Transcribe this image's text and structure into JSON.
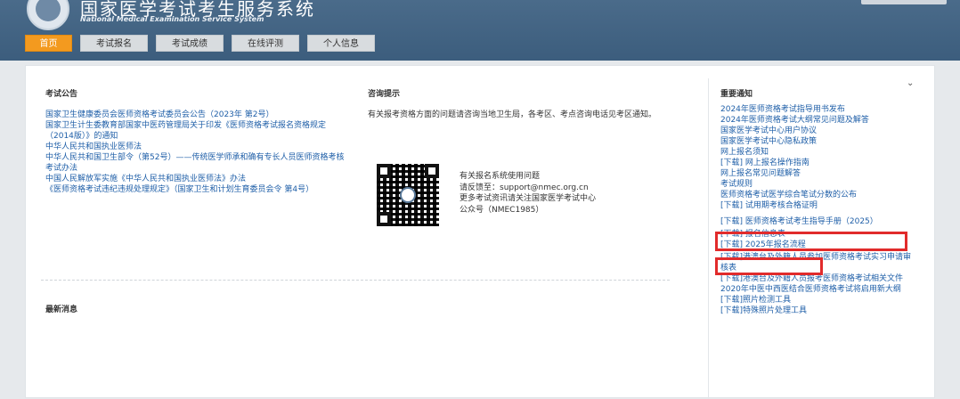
{
  "header": {
    "title": "国家医学考试考生服务系统",
    "subtitle": "National Medical Examination Service System"
  },
  "nav": {
    "items": [
      {
        "label": "首页"
      },
      {
        "label": "考试报名"
      },
      {
        "label": "考试成绩"
      },
      {
        "label": "在线评测"
      },
      {
        "label": "个人信息"
      }
    ]
  },
  "announcements": {
    "title": "考试公告",
    "items": [
      "国家卫生健康委员会医师资格考试委员会公告（2023年 第2号）",
      "国家卫生计生委教育部国家中医药管理局关于印发《医师资格考试报名资格规定（2014版）》的通知",
      "中华人民共和国执业医师法",
      "中华人民共和国卫生部令（第52号）——传统医学师承和确有专长人员医师资格考核考试办法",
      "中国人民解放军实施《中华人民共和国执业医师法》办法",
      "《医师资格考试违纪违规处理规定》（国家卫生和计划生育委员会令 第4号）"
    ]
  },
  "consult": {
    "title": "咨询提示",
    "text": "有关报考资格方面的问题请咨询当地卫生局，各考区、考点咨询电话见考区通知。",
    "contact_lines": [
      "有关报名系统使用问题",
      "请反馈至：support@nmec.org.cn",
      "更多考试资讯请关注国家医学考试中心",
      "公众号（NMEC1985）"
    ]
  },
  "latest": {
    "title": "最新消息"
  },
  "important": {
    "title": "重要通知",
    "items": [
      "2024年医师资格考试指导用书发布",
      "2024年医师资格考试大纲常见问题及解答",
      "国家医学考试中心用户协议",
      "国家医学考试中心隐私政策",
      "网上报名须知",
      "[下载] 网上报名操作指南",
      "网上报名常见问题解答",
      "考试规则",
      "医师资格考试医学综合笔试分数的公布",
      "[下载] 试用期考核合格证明",
      "[下载] 医师资格考试考生指导手册（2025）",
      "[下载] 报名信息表",
      "[下载] 2025年报名流程",
      "[下载]港澳台及外籍人员参加医师资格考试实习申请审核表",
      "[下载]港澳台及外籍人员报考医师资格考试相关文件",
      "2020年中医中西医结合医师资格考试将启用新大纲",
      "[下载]照片检测工具",
      "[下载]特殊照片处理工具"
    ]
  },
  "colors": {
    "header_bg": "#3c5d7d",
    "nav_active": "#f39a1f",
    "link": "#1f5fa8",
    "highlight": "#e12b2b"
  }
}
